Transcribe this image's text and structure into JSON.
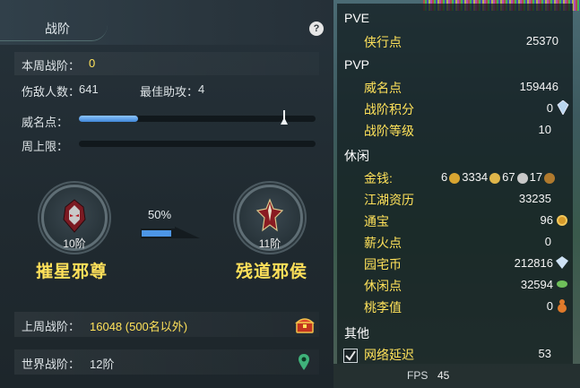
{
  "left_panel": {
    "title": "战阶",
    "help_label": "?",
    "weekly_label": "本周战阶：",
    "weekly_value": "0",
    "injured_label": "伤敌人数：",
    "injured_value": "641",
    "best_assist_label": "最佳助攻：",
    "best_assist_value": "4",
    "prestige_label": "威名点：",
    "prestige_fill_fraction": 0.25,
    "weekly_cap_label": "周上限：",
    "progress_percent": "50%",
    "progress_fraction": 0.5,
    "current_rank": {
      "level": "10阶",
      "name": "摧星邪尊"
    },
    "next_rank": {
      "level": "11阶",
      "name": "残道邪侯"
    },
    "last_week_label": "上周战阶：",
    "last_week_value": "16048 (500名以外)",
    "world_label": "世界战阶：",
    "world_value": "12阶"
  },
  "right_panel": {
    "pve": {
      "header": "PVE",
      "items": [
        {
          "label": "侠行点",
          "value": "25370"
        }
      ]
    },
    "pvp": {
      "header": "PVP",
      "items": [
        {
          "label": "威名点",
          "value": "159446"
        },
        {
          "label": "战阶积分",
          "value": "0"
        },
        {
          "label": "战阶等级",
          "value": "10"
        }
      ]
    },
    "leisure": {
      "header": "休闲",
      "coins_label": "金钱:",
      "coins": [
        "6",
        "3334",
        "67",
        "17"
      ],
      "items": [
        {
          "label": "江湖资历",
          "value": "33235"
        },
        {
          "label": "通宝",
          "value": "96"
        },
        {
          "label": "薪火点",
          "value": "0"
        },
        {
          "label": "园宅币",
          "value": "212816"
        },
        {
          "label": "休闲点",
          "value": "32594"
        },
        {
          "label": "桃李值",
          "value": "0"
        }
      ]
    },
    "other": {
      "header": "其他",
      "network_label": "网络延迟",
      "network_value": "53"
    },
    "footer": {
      "fps_label": "FPS",
      "fps_value": "45"
    }
  },
  "colors": {
    "accent_yellow": "#ffe25a",
    "bar_blue": "#4d96e6"
  }
}
